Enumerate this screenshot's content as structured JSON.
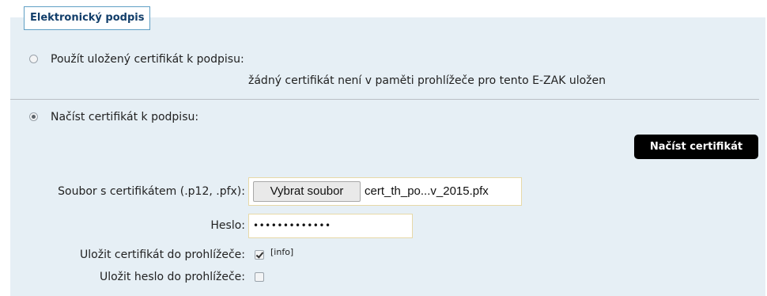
{
  "fieldset": {
    "legend": "Elektronický podpis"
  },
  "stored_cert": {
    "label": "Použít uložený certifikát k podpisu:",
    "note": "žádný certifikát není v paměti prohlížeče pro tento E-ZAK uložen",
    "selected": false
  },
  "load_cert": {
    "label": "Načíst certifikát k podpisu:",
    "selected": true,
    "button_label": "Načíst certifikát"
  },
  "form": {
    "file_label": "Soubor s certifikátem (.p12, .pfx):",
    "file_button": "Vybrat soubor",
    "file_name": "cert_th_po...v_2015.pfx",
    "password_label": "Heslo:",
    "password_value": "•••••••••••••",
    "save_cert_label": "Uložit certifikát do prohlížeče:",
    "save_cert_checked": true,
    "info_link": "[info]",
    "save_password_label": "Uložit heslo do prohlížeče:",
    "save_password_checked": false
  },
  "colors": {
    "panel_bg": "#e6eff5",
    "legend_border": "#5f9fc4",
    "legend_text": "#123e6a",
    "primary_button_bg": "#000000",
    "input_border": "#e7d9a8"
  }
}
